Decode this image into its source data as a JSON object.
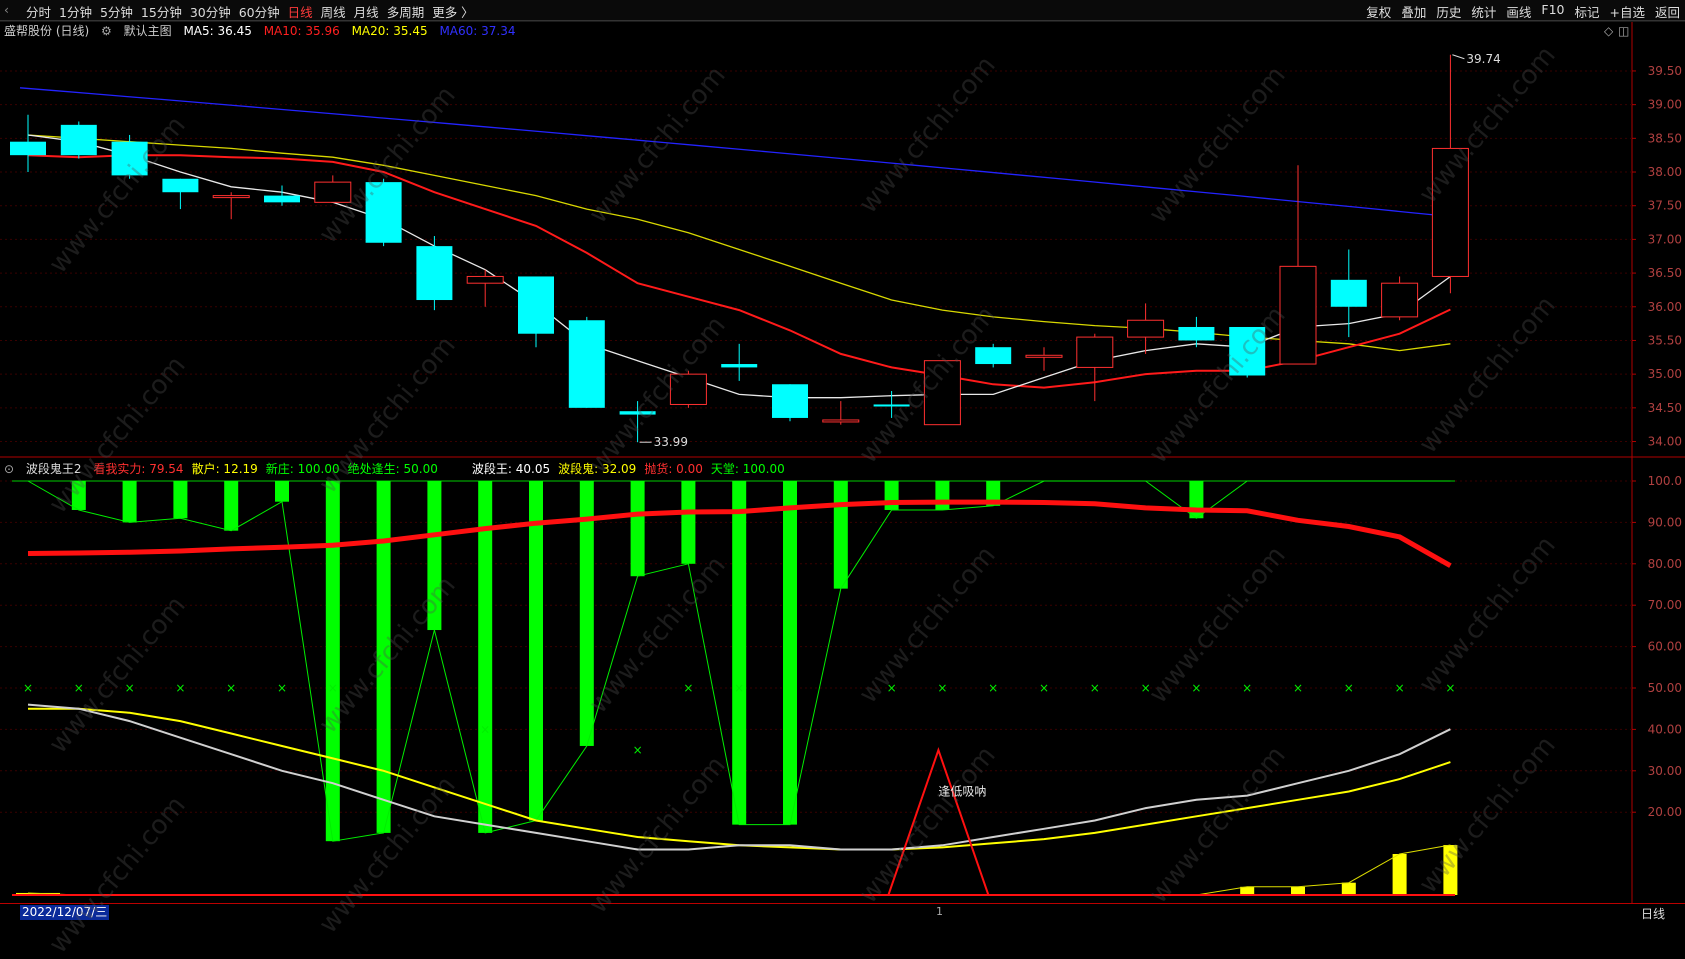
{
  "toolbar": {
    "left_items": [
      "分时",
      "1分钟",
      "5分钟",
      "15分钟",
      "30分钟",
      "60分钟",
      "日线",
      "周线",
      "月线",
      "多周期",
      "更多 〉"
    ],
    "active_item": "日线",
    "right_items": [
      "复权",
      "叠加",
      "历史",
      "统计",
      "画线",
      "F10",
      "标记",
      "+自选",
      "返回"
    ]
  },
  "main_legend": {
    "title": "盛帮股份 (日线)",
    "template": "默认主图",
    "ma5": {
      "label": "MA5: 36.45",
      "color": "#ffffff"
    },
    "ma10": {
      "label": "MA10: 35.96",
      "color": "#ff2020"
    },
    "ma20": {
      "label": "MA20: 35.45",
      "color": "#ffff00"
    },
    "ma60": {
      "label": "MA60: 37.34",
      "color": "#2020ff"
    }
  },
  "price_axis": {
    "ticks": [
      "39.50",
      "39.00",
      "38.50",
      "38.00",
      "37.50",
      "37.00",
      "36.50",
      "36.00",
      "35.50",
      "35.00",
      "34.50",
      "34.00"
    ],
    "high_label": "39.74",
    "low_label": "33.99"
  },
  "indicator_legend": {
    "name": "波段鬼王2",
    "items": [
      {
        "label": "看我实力: 79.54",
        "color": "#ff3030"
      },
      {
        "label": "散户: 12.19",
        "color": "#ffff00"
      },
      {
        "label": "新庄: 100.00",
        "color": "#00ff00"
      },
      {
        "label": "绝处逢生: 50.00",
        "color": "#00ff00"
      },
      {
        "label": "波段王: 40.05",
        "color": "#ffffff"
      },
      {
        "label": "波段鬼: 32.09",
        "color": "#ffff00"
      },
      {
        "label": "抛货: 0.00",
        "color": "#ff3030"
      },
      {
        "label": "天堂: 100.00",
        "color": "#00ff00"
      }
    ]
  },
  "indicator_axis": {
    "ticks": [
      "100.0",
      "90.00",
      "80.00",
      "70.00",
      "60.00",
      "50.00",
      "40.00",
      "30.00",
      "20.00"
    ]
  },
  "annotation": "逢低吸呐",
  "status": {
    "date": "2022/12/07/三",
    "cursor": "1",
    "period": "日线"
  },
  "watermark": "www.cfchi.com",
  "chart_data": {
    "type": "candlestick",
    "price_ylim": [
      33.8,
      39.9
    ],
    "candles": [
      {
        "o": 38.45,
        "h": 38.85,
        "l": 38.0,
        "c": 38.25
      },
      {
        "o": 38.7,
        "h": 38.75,
        "l": 38.2,
        "c": 38.25
      },
      {
        "o": 38.45,
        "h": 38.55,
        "l": 37.9,
        "c": 37.95
      },
      {
        "o": 37.9,
        "h": 37.9,
        "l": 37.45,
        "c": 37.7
      },
      {
        "o": 37.65,
        "h": 37.7,
        "l": 37.3,
        "c": 37.65
      },
      {
        "o": 37.65,
        "h": 37.8,
        "l": 37.5,
        "c": 37.55
      },
      {
        "o": 37.55,
        "h": 37.95,
        "l": 37.55,
        "c": 37.85
      },
      {
        "o": 37.85,
        "h": 37.9,
        "l": 36.9,
        "c": 36.95
      },
      {
        "o": 36.9,
        "h": 37.05,
        "l": 35.95,
        "c": 36.1
      },
      {
        "o": 36.35,
        "h": 36.55,
        "l": 36.0,
        "c": 36.45
      },
      {
        "o": 36.45,
        "h": 36.45,
        "l": 35.4,
        "c": 35.6
      },
      {
        "o": 35.8,
        "h": 35.85,
        "l": 34.5,
        "c": 34.5
      },
      {
        "o": 34.45,
        "h": 34.6,
        "l": 33.99,
        "c": 34.4
      },
      {
        "o": 34.55,
        "h": 35.05,
        "l": 34.5,
        "c": 35.0
      },
      {
        "o": 35.15,
        "h": 35.45,
        "l": 34.9,
        "c": 35.1
      },
      {
        "o": 34.85,
        "h": 34.85,
        "l": 34.3,
        "c": 34.35
      },
      {
        "o": 34.3,
        "h": 34.6,
        "l": 34.25,
        "c": 34.32
      },
      {
        "o": 34.55,
        "h": 34.75,
        "l": 34.35,
        "c": 34.52
      },
      {
        "o": 34.25,
        "h": 35.2,
        "l": 34.25,
        "c": 35.2
      },
      {
        "o": 35.4,
        "h": 35.45,
        "l": 35.1,
        "c": 35.15
      },
      {
        "o": 35.25,
        "h": 35.4,
        "l": 35.05,
        "c": 35.28
      },
      {
        "o": 35.1,
        "h": 35.6,
        "l": 34.6,
        "c": 35.55
      },
      {
        "o": 35.55,
        "h": 36.05,
        "l": 35.3,
        "c": 35.8
      },
      {
        "o": 35.7,
        "h": 35.85,
        "l": 35.4,
        "c": 35.5
      },
      {
        "o": 35.7,
        "h": 35.7,
        "l": 34.95,
        "c": 34.98
      },
      {
        "o": 35.15,
        "h": 38.1,
        "l": 35.15,
        "c": 36.6
      },
      {
        "o": 36.4,
        "h": 36.85,
        "l": 35.55,
        "c": 36.0
      },
      {
        "o": 35.85,
        "h": 36.45,
        "l": 35.8,
        "c": 36.35
      },
      {
        "o": 36.45,
        "h": 39.74,
        "l": 36.2,
        "c": 38.35
      }
    ],
    "ma5": [
      38.55,
      38.45,
      38.25,
      38.0,
      37.78,
      37.7,
      37.55,
      37.3,
      36.9,
      36.55,
      36.05,
      35.45,
      35.2,
      34.95,
      34.7,
      34.65,
      34.65,
      34.68,
      34.7,
      34.7,
      34.95,
      35.2,
      35.35,
      35.45,
      35.4,
      35.7,
      35.75,
      35.9,
      36.45
    ],
    "ma10": [
      38.25,
      38.22,
      38.25,
      38.25,
      38.22,
      38.2,
      38.15,
      38.0,
      37.7,
      37.45,
      37.2,
      36.8,
      36.35,
      36.15,
      35.95,
      35.65,
      35.3,
      35.1,
      34.98,
      34.85,
      34.8,
      34.88,
      35.0,
      35.05,
      35.05,
      35.2,
      35.4,
      35.6,
      35.96
    ],
    "ma20": [
      38.55,
      38.5,
      38.45,
      38.4,
      38.35,
      38.28,
      38.22,
      38.1,
      37.95,
      37.8,
      37.65,
      37.45,
      37.3,
      37.1,
      36.85,
      36.6,
      36.35,
      36.1,
      35.95,
      35.85,
      35.78,
      35.72,
      35.68,
      35.62,
      35.55,
      35.5,
      35.45,
      35.35,
      35.45
    ],
    "ma60_start": 39.25,
    "ma60_end": 37.34,
    "indicator_ylim": [
      0,
      100
    ],
    "strength": [
      82.5,
      82.6,
      82.8,
      83.1,
      83.6,
      84.0,
      84.5,
      85.5,
      87.0,
      88.5,
      89.8,
      90.8,
      92.0,
      92.5,
      92.6,
      93.5,
      94.3,
      94.8,
      94.9,
      94.9,
      94.8,
      94.5,
      93.5,
      93.0,
      92.8,
      90.5,
      89.0,
      86.5,
      79.54
    ],
    "bars_bottom": [
      100,
      93,
      90,
      91,
      88,
      95,
      13,
      15,
      64,
      15,
      18,
      36,
      77,
      80,
      17,
      17,
      74,
      93,
      93,
      94,
      100,
      100,
      100,
      91,
      100,
      100,
      100,
      100,
      100
    ],
    "green_bars": [
      0,
      1,
      1,
      1,
      1,
      1,
      1,
      1,
      1,
      1,
      1,
      1,
      1,
      1,
      1,
      1,
      1,
      1,
      1,
      1,
      0,
      0,
      0,
      1,
      0,
      0,
      0,
      0,
      0
    ],
    "x_marks": [
      50,
      50,
      50,
      50,
      50,
      50,
      50,
      0,
      0,
      40,
      0,
      0,
      35,
      50,
      50,
      0,
      0,
      50,
      50,
      50,
      50,
      50,
      50,
      50,
      50,
      50,
      50,
      50,
      50
    ],
    "wave_king": [
      46,
      45,
      42,
      38,
      34,
      30,
      27,
      23,
      19,
      17,
      15,
      13,
      11,
      11,
      12,
      12,
      11,
      11,
      12,
      14,
      16,
      18,
      21,
      23,
      24,
      27,
      30,
      34,
      40.05
    ],
    "wave_ghost": [
      45,
      45,
      44,
      42,
      39,
      36,
      33,
      30,
      26,
      22,
      18,
      16,
      14,
      13,
      12,
      11.5,
      11,
      11,
      11.5,
      12.5,
      13.5,
      15,
      17,
      19,
      21,
      23,
      25,
      28,
      32.09
    ],
    "dip_triangle_peak": 35,
    "retail_bars": [
      0.5,
      0,
      0,
      0,
      0,
      0,
      0,
      0,
      0,
      0,
      0,
      0,
      0,
      0,
      0,
      0,
      0,
      0,
      0,
      0,
      0,
      0,
      0,
      0,
      2,
      2,
      3,
      10,
      12.19
    ]
  }
}
